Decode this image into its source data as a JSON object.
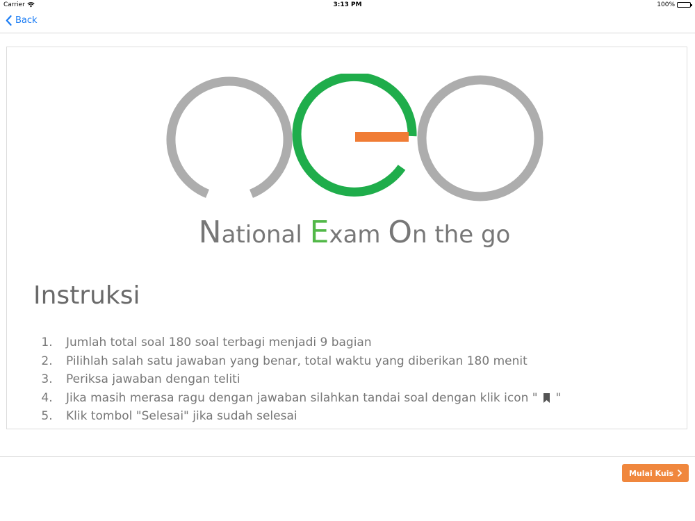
{
  "status_bar": {
    "carrier": "Carrier",
    "time": "3:13 PM",
    "battery": "100%",
    "icons": [
      "wifi-icon",
      "battery-icon"
    ]
  },
  "nav": {
    "back_label": "Back",
    "back_icon": "chevron-left-icon",
    "accent_color": "#1a7cf4"
  },
  "logo": {
    "tagline_words": [
      {
        "initial": "N",
        "rest": "ational"
      },
      {
        "initial": "E",
        "rest": "xam"
      },
      {
        "initial": "O",
        "rest": "n the go"
      }
    ],
    "colors": {
      "gray": "#adadad",
      "green": "#1fad4b",
      "orange": "#f07c35"
    }
  },
  "instructions": {
    "title": "Instruksi",
    "items": [
      {
        "num": "1.",
        "text": "Jumlah total soal 180 soal terbagi menjadi 9 bagian"
      },
      {
        "num": "2.",
        "text": "Pilihlah salah satu jawaban yang benar, total waktu yang diberikan 180 menit"
      },
      {
        "num": "3.",
        "text": "Periksa jawaban dengan teliti"
      },
      {
        "num": "4.",
        "text": "Jika masih merasa ragu dengan jawaban silahkan tandai soal dengan klik icon \"",
        "suffix": "\"",
        "icon": "bookmark-icon"
      },
      {
        "num": "5.",
        "text": "Klik tombol \"Selesai\" jika sudah selesai"
      }
    ]
  },
  "footer": {
    "start_label": "Mulai Kuis",
    "start_icon": "chevron-right-icon",
    "start_color": "#f0873d"
  }
}
